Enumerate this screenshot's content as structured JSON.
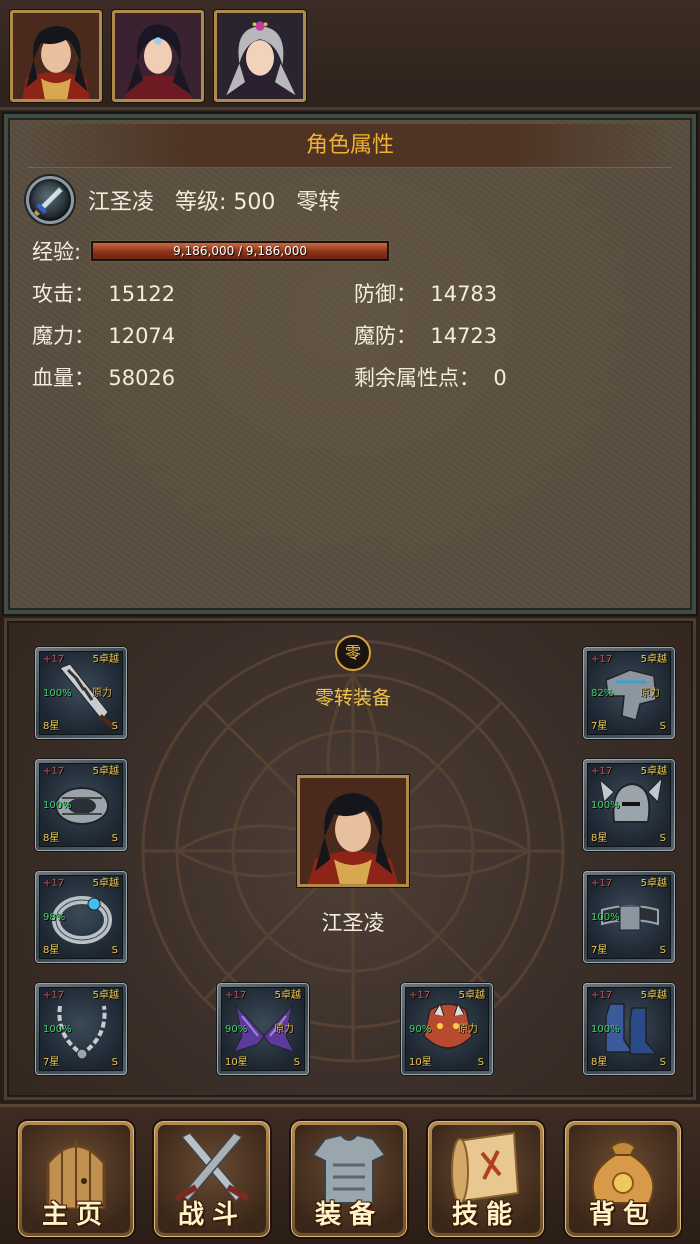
{
  "heroes": [
    {
      "name": "hero-portrait-1",
      "hair": "#14161c",
      "robe": "#8e2418"
    },
    {
      "name": "hero-portrait-2",
      "hair": "#1a1624",
      "robe": "#6e1a22"
    },
    {
      "name": "hero-portrait-3",
      "hair": "#b8b8bc",
      "robe": "#2a2030"
    }
  ],
  "attributes": {
    "title": "角色属性",
    "char_line": "江圣凌   等级: 500   零转",
    "exp_label": "经验:",
    "exp_text": "9,186,000 / 9,186,000",
    "exp_fraction": 1.0,
    "attack": "攻击：  15122",
    "defense": "防御：  14783",
    "magic": "魔力：  12074",
    "magic_defense": "魔防：  14723",
    "hp": "血量：  58026",
    "remaining_points": "剩余属性点：  0"
  },
  "equipment": {
    "tier_badge": "零",
    "title": "零转装备",
    "character_name": "江圣凌",
    "slots": [
      {
        "icon": "blade-icon",
        "plus": "+17",
        "excellent": "5卓越",
        "pct": "100%",
        "orig": "原力",
        "stars": "8星",
        "grade": "S"
      },
      {
        "icon": "shoulder-armor-icon",
        "plus": "+17",
        "excellent": "5卓越",
        "pct": "82%",
        "orig": "原力",
        "stars": "7星",
        "grade": "S"
      },
      {
        "icon": "bracer-icon",
        "plus": "+17",
        "excellent": "5卓越",
        "pct": "100%",
        "orig": "",
        "stars": "8星",
        "grade": "S"
      },
      {
        "icon": "winged-helmet-icon",
        "plus": "+17",
        "excellent": "5卓越",
        "pct": "100%",
        "orig": "",
        "stars": "8星",
        "grade": "S"
      },
      {
        "icon": "ring-icon",
        "plus": "+17",
        "excellent": "5卓越",
        "pct": "98%",
        "orig": "",
        "stars": "8星",
        "grade": "S"
      },
      {
        "icon": "belt-icon",
        "plus": "+17",
        "excellent": "5卓越",
        "pct": "100%",
        "orig": "",
        "stars": "7星",
        "grade": "S"
      },
      {
        "icon": "chain-necklace-icon",
        "plus": "+17",
        "excellent": "5卓越",
        "pct": "100%",
        "orig": "",
        "stars": "7星",
        "grade": "S"
      },
      {
        "icon": "wings-icon",
        "plus": "+17",
        "excellent": "5卓越",
        "pct": "90%",
        "orig": "原力",
        "stars": "10星",
        "grade": "S"
      },
      {
        "icon": "beast-pet-icon",
        "plus": "+17",
        "excellent": "5卓越",
        "pct": "90%",
        "orig": "原力",
        "stars": "10星",
        "grade": "S"
      },
      {
        "icon": "boots-icon",
        "plus": "+17",
        "excellent": "5卓越",
        "pct": "100%",
        "orig": "",
        "stars": "8星",
        "grade": "S"
      }
    ]
  },
  "nav": [
    {
      "label": "主页",
      "icon": "door-icon"
    },
    {
      "label": "战斗",
      "icon": "crossed-swords-icon"
    },
    {
      "label": "装备",
      "icon": "armor-icon"
    },
    {
      "label": "技能",
      "icon": "scroll-icon"
    },
    {
      "label": "背包",
      "icon": "bag-icon"
    }
  ]
}
